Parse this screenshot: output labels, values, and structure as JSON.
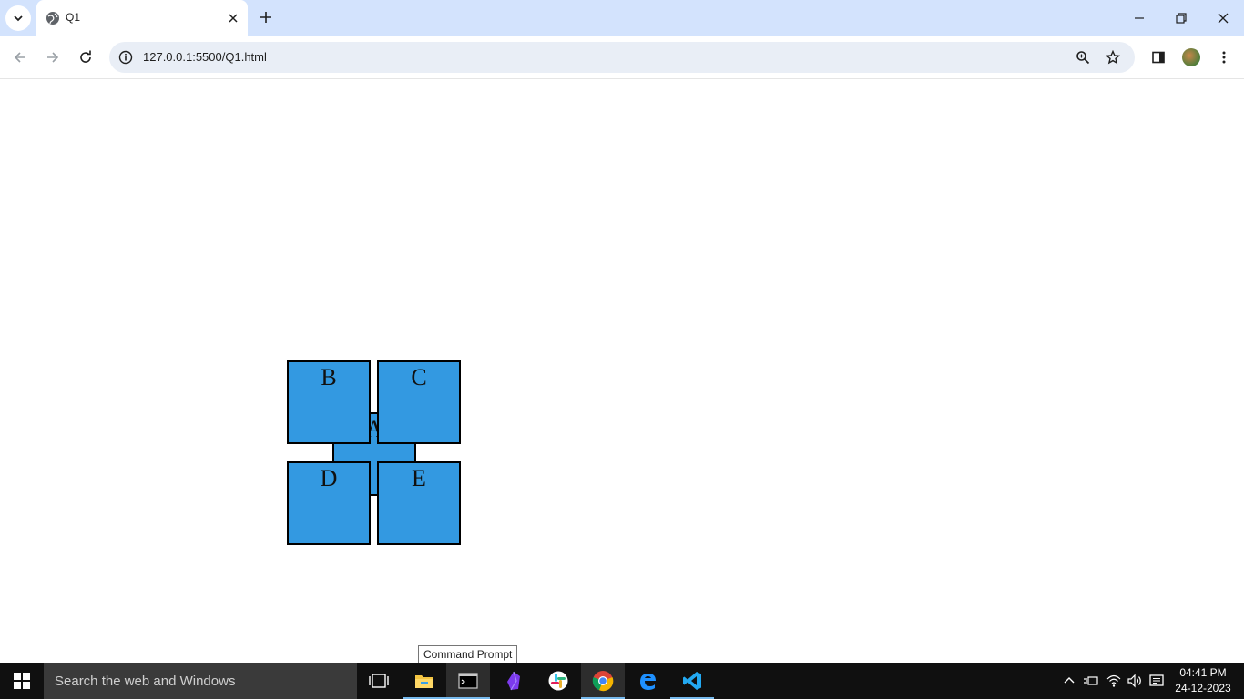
{
  "browser": {
    "tab": {
      "title": "Q1"
    },
    "address_bar": {
      "url": "127.0.0.1:5500/Q1.html"
    },
    "icons": {
      "tab_search": "chevron-down-icon",
      "favicon": "globe-icon",
      "tab_close": "close-icon",
      "new_tab": "plus-icon",
      "minimize": "minimize-icon",
      "restore": "restore-icon",
      "close_window": "close-icon",
      "back": "arrow-left-icon",
      "forward": "arrow-right-icon",
      "reload": "reload-icon",
      "site_info": "info-icon",
      "zoom": "zoom-icon",
      "bookmark": "star-icon",
      "side_panel": "side-panel-icon",
      "menu": "more-vert-icon"
    }
  },
  "page": {
    "boxes": {
      "a": "A",
      "b": "B",
      "c": "C",
      "d": "D",
      "e": "E"
    },
    "box_color": "#3399e1"
  },
  "tooltip": {
    "text": "Command Prompt"
  },
  "taskbar": {
    "search_placeholder": "Search the web and Windows",
    "apps": [
      "task-view-icon",
      "file-explorer-icon",
      "command-prompt-icon",
      "obsidian-icon",
      "slack-icon",
      "chrome-icon",
      "edge-icon",
      "vscode-icon"
    ],
    "clock": {
      "time": "04:41 PM",
      "date": "24-12-2023"
    }
  }
}
